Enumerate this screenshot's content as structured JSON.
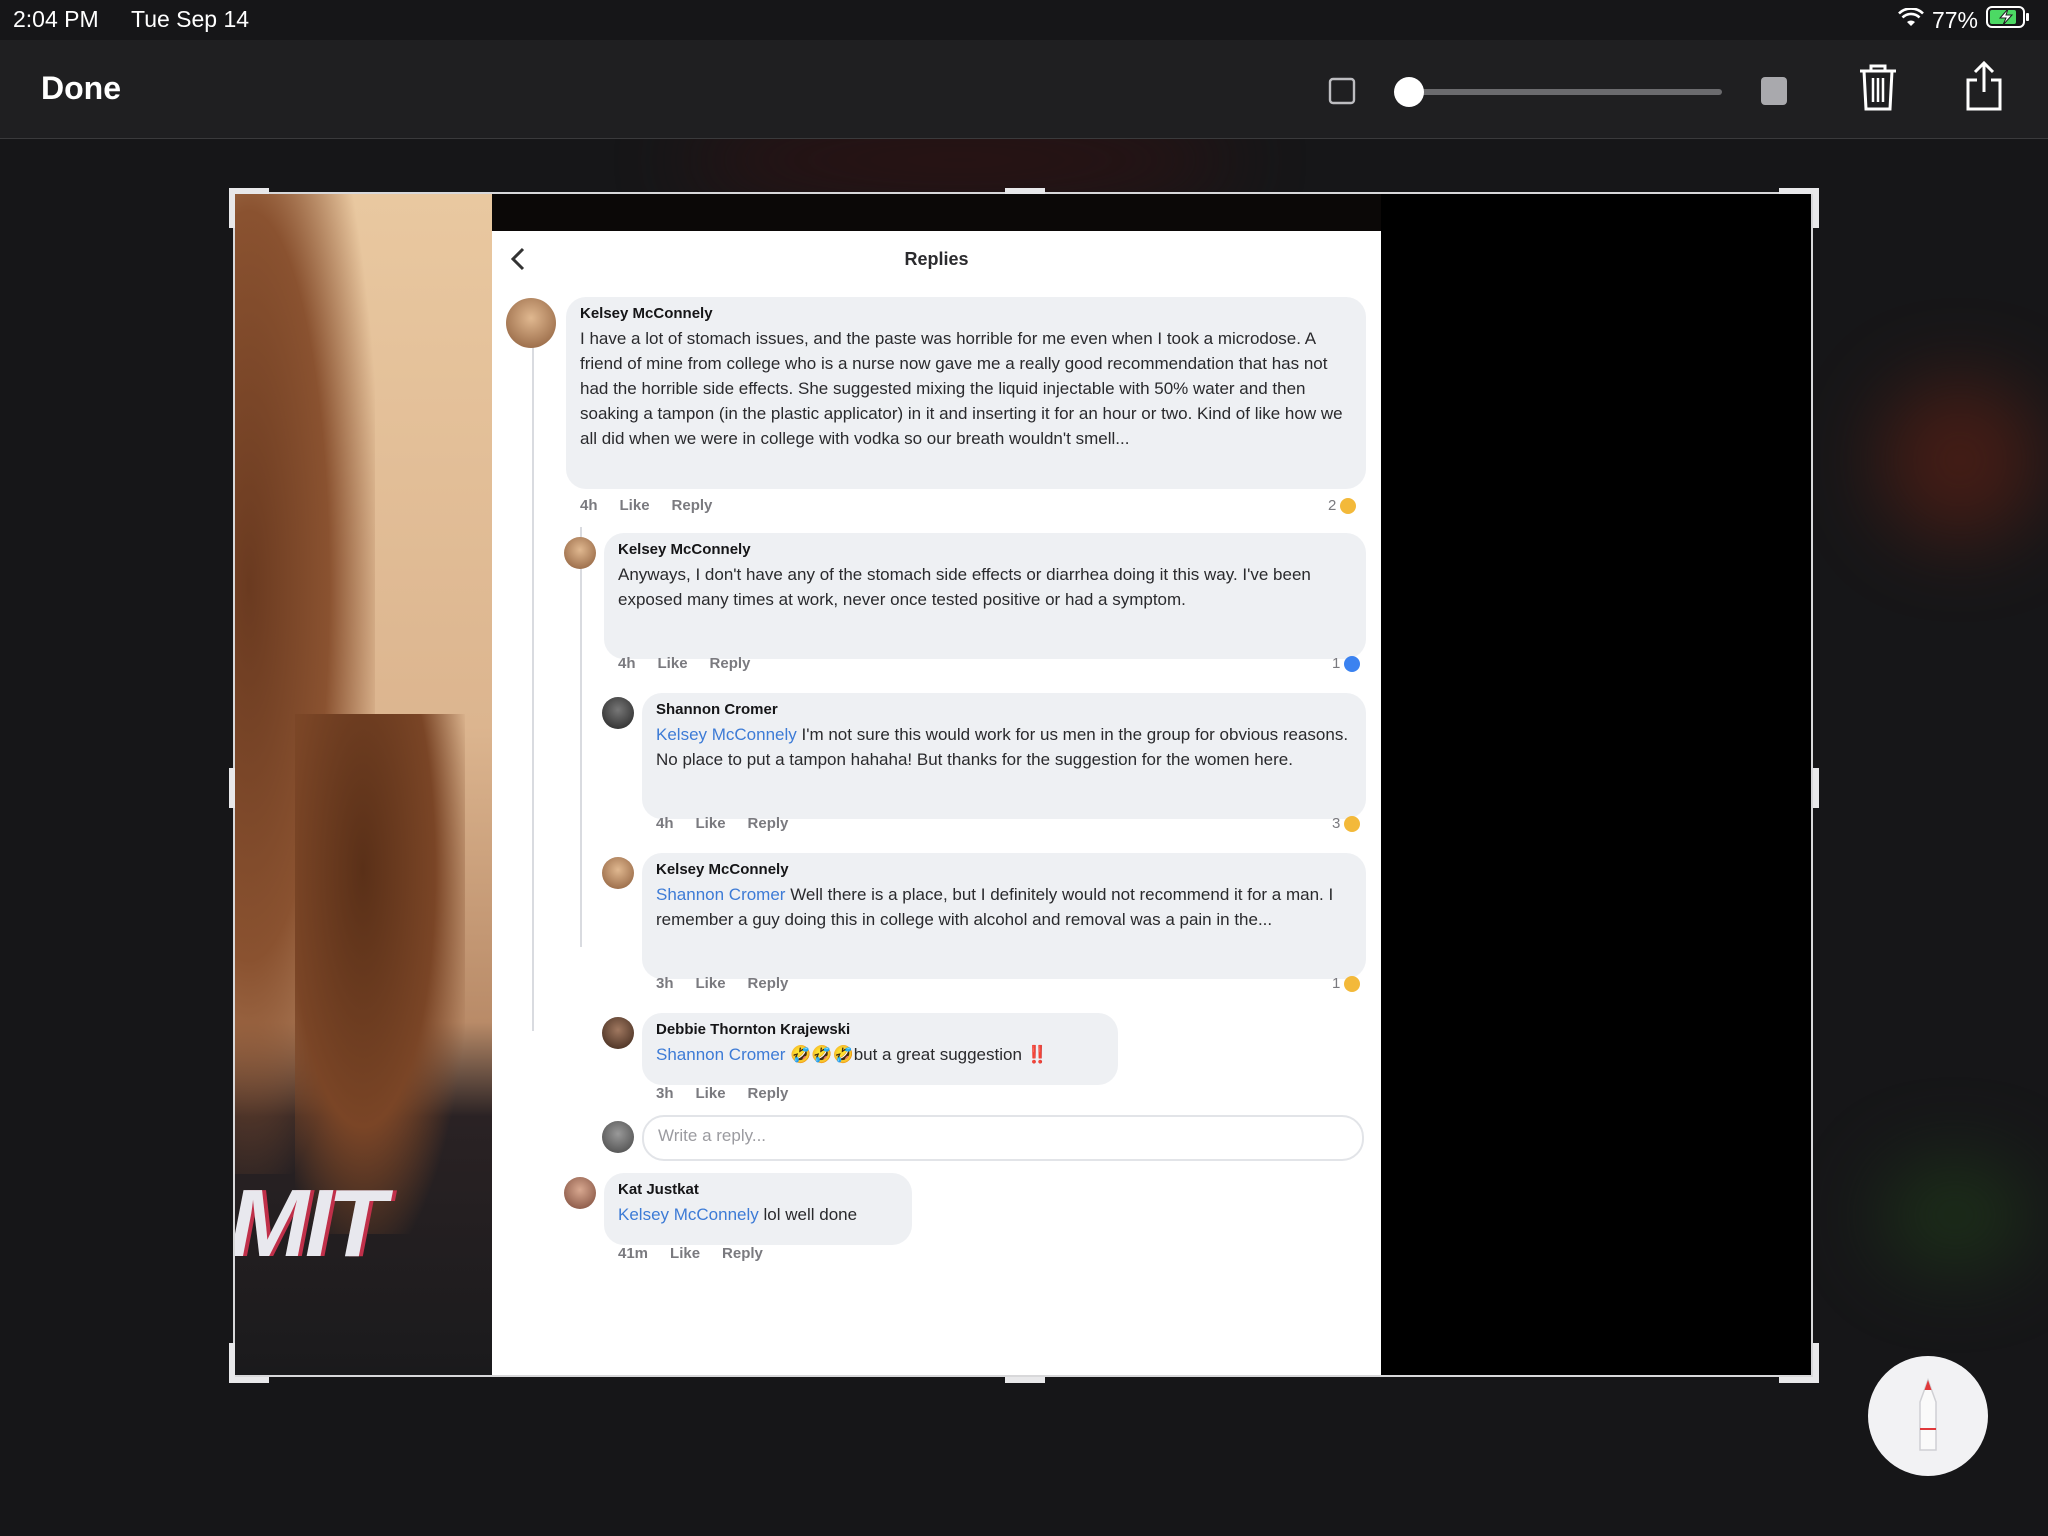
{
  "status_bar": {
    "time": "2:04 PM",
    "date": "Tue Sep 14",
    "battery": "77%"
  },
  "toolbar": {
    "done_label": "Done",
    "volume_level": 0.0,
    "icons": [
      "square-outline-icon",
      "slider",
      "square-filled-icon",
      "trash-icon",
      "share-icon"
    ]
  },
  "replies_panel": {
    "title": "Replies",
    "comments": [
      {
        "author": "Kelsey McConnely",
        "mention": "",
        "text": "I have a lot of stomach issues, and the paste was horrible for me even when I took a microdose. A friend of mine from college who is a nurse now gave me a really good recommendation that has not had the horrible side effects. She suggested mixing the liquid injectable with 50% water and then soaking a tampon (in the plastic applicator) in it and inserting it for an hour or two. Kind of like how we all did when we were in college with vodka so our breath wouldn't smell...",
        "time": "4h",
        "like": "Like",
        "reply": "Reply",
        "reactions": "2"
      },
      {
        "author": "Kelsey McConnely",
        "mention": "",
        "text": "Anyways, I don't have any of the stomach side effects or diarrhea doing it this way. I've been exposed many times at work, never once tested positive or had a symptom.",
        "time": "4h",
        "like": "Like",
        "reply": "Reply",
        "reactions": "1"
      },
      {
        "author": "Shannon Cromer",
        "mention": "Kelsey McConnely",
        "text": " I'm not sure this would work for us men in the group for obvious reasons. No place to put a tampon hahaha! But thanks for the suggestion for the women here.",
        "time": "4h",
        "like": "Like",
        "reply": "Reply",
        "reactions": "3"
      },
      {
        "author": "Kelsey McConnely",
        "mention": "Shannon Cromer",
        "text": " Well there is a place, but I definitely would not recommend it for a man. I remember a guy doing this in college with alcohol and removal was a pain in the...",
        "time": "3h",
        "like": "Like",
        "reply": "Reply",
        "reactions": "1"
      },
      {
        "author": "Debbie Thornton Krajewski",
        "mention": "Shannon Cromer",
        "text": " 🤣🤣🤣but a great suggestion ‼️",
        "time": "3h",
        "like": "Like",
        "reply": "Reply",
        "reactions": ""
      },
      {
        "author": "Kat Justkat",
        "mention": "Kelsey McConnely",
        "text": " lol well done",
        "time": "41m",
        "like": "Like",
        "reply": "Reply",
        "reactions": ""
      }
    ],
    "reply_placeholder": "Write a reply..."
  },
  "photo_text": "MIT",
  "colors": {
    "accent_link": "#3d7bd6",
    "background": "#161618",
    "battery_green": "#4cd964"
  }
}
